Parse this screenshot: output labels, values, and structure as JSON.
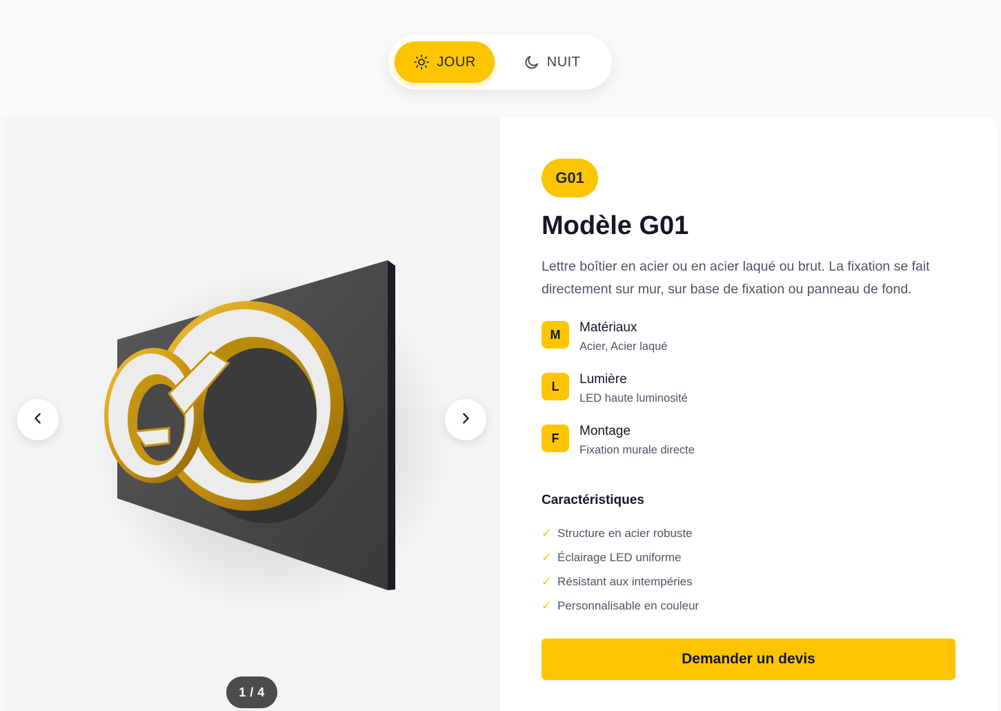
{
  "toggle": {
    "day_label": "JOUR",
    "night_label": "NUIT",
    "day_icon": "sun-icon",
    "night_icon": "moon-icon",
    "active": "day"
  },
  "gallery": {
    "counter": "1 / 4",
    "prev_icon": "chevron-left-icon",
    "next_icon": "chevron-right-icon",
    "logo_letter": "G"
  },
  "product": {
    "badge": "G01",
    "title": "Modèle G01",
    "description": "Lettre boîtier en acier ou en acier laqué ou brut. La fixation se fait directement sur mur, sur base de fixation ou panneau de fond.",
    "specs": [
      {
        "letter": "M",
        "title": "Matériaux",
        "value": "Acier, Acier laqué"
      },
      {
        "letter": "L",
        "title": "Lumière",
        "value": "LED haute luminosité"
      },
      {
        "letter": "F",
        "title": "Montage",
        "value": "Fixation murale directe"
      }
    ],
    "features_title": "Caractéristiques",
    "check_glyph": "✓",
    "features": [
      "Structure en acier robuste",
      "Éclairage LED uniforme",
      "Résistant aux intempéries",
      "Personnalisable en couleur"
    ],
    "cta_label": "Demander un devis"
  },
  "colors": {
    "accent": "#fdc500",
    "text_dark": "#111827",
    "text_muted": "#4b5563",
    "panel_bg": "#f3f4f6",
    "counter_bg": "#4b4b4b"
  }
}
